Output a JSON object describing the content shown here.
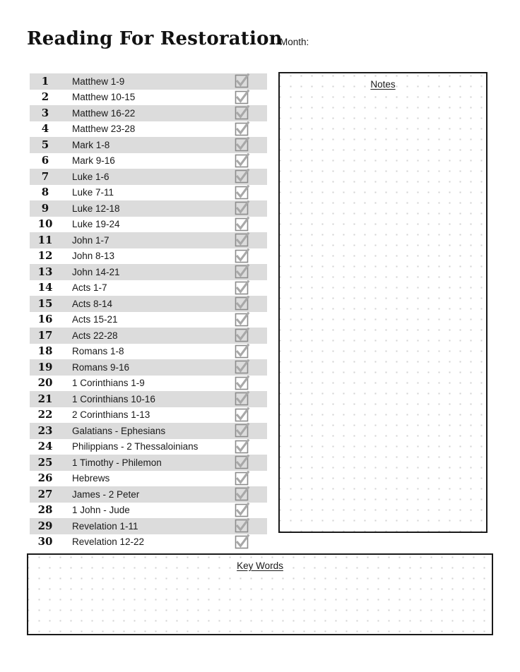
{
  "header": {
    "title": "Reading For Restoration",
    "month_label": "Month:",
    "month_value": ""
  },
  "reading_plan": {
    "rows": [
      {
        "number": "1",
        "passage": "Matthew 1-9"
      },
      {
        "number": "2",
        "passage": "Matthew 10-15"
      },
      {
        "number": "3",
        "passage": "Matthew 16-22"
      },
      {
        "number": "4",
        "passage": "Matthew 23-28"
      },
      {
        "number": "5",
        "passage": "Mark 1-8"
      },
      {
        "number": "6",
        "passage": "Mark 9-16"
      },
      {
        "number": "7",
        "passage": "Luke 1-6"
      },
      {
        "number": "8",
        "passage": "Luke 7-11"
      },
      {
        "number": "9",
        "passage": "Luke 12-18"
      },
      {
        "number": "10",
        "passage": "Luke 19-24"
      },
      {
        "number": "11",
        "passage": "John 1-7"
      },
      {
        "number": "12",
        "passage": "John 8-13"
      },
      {
        "number": "13",
        "passage": "John 14-21"
      },
      {
        "number": "14",
        "passage": "Acts 1-7"
      },
      {
        "number": "15",
        "passage": "Acts 8-14"
      },
      {
        "number": "16",
        "passage": "Acts 15-21"
      },
      {
        "number": "17",
        "passage": "Acts 22-28"
      },
      {
        "number": "18",
        "passage": "Romans 1-8"
      },
      {
        "number": "19",
        "passage": "Romans 9-16"
      },
      {
        "number": "20",
        "passage": "1 Corinthians 1-9"
      },
      {
        "number": "21",
        "passage": "1 Corinthians 10-16"
      },
      {
        "number": "22",
        "passage": "2 Corinthians 1-13"
      },
      {
        "number": "23",
        "passage": "Galatians - Ephesians"
      },
      {
        "number": "24",
        "passage": "Philippians - 2 Thessaloinians"
      },
      {
        "number": "25",
        "passage": "1 Timothy - Philemon"
      },
      {
        "number": "26",
        "passage": "Hebrews"
      },
      {
        "number": "27",
        "passage": "James - 2 Peter"
      },
      {
        "number": "28",
        "passage": "1 John - Jude"
      },
      {
        "number": "29",
        "passage": "Revelation 1-11"
      },
      {
        "number": "30",
        "passage": "Revelation 12-22"
      }
    ]
  },
  "notes_panel": {
    "title": "Notes",
    "content": ""
  },
  "keywords_panel": {
    "title": "Key Words",
    "content": ""
  },
  "colors": {
    "row_stripe": "#dcdcdc",
    "checkbox_border": "#8c8c8c",
    "checkmark": "#a8a8a8",
    "panel_border": "#1a1a1a",
    "dot_grid": "#d2d2d2",
    "text": "#1a1a1a"
  }
}
